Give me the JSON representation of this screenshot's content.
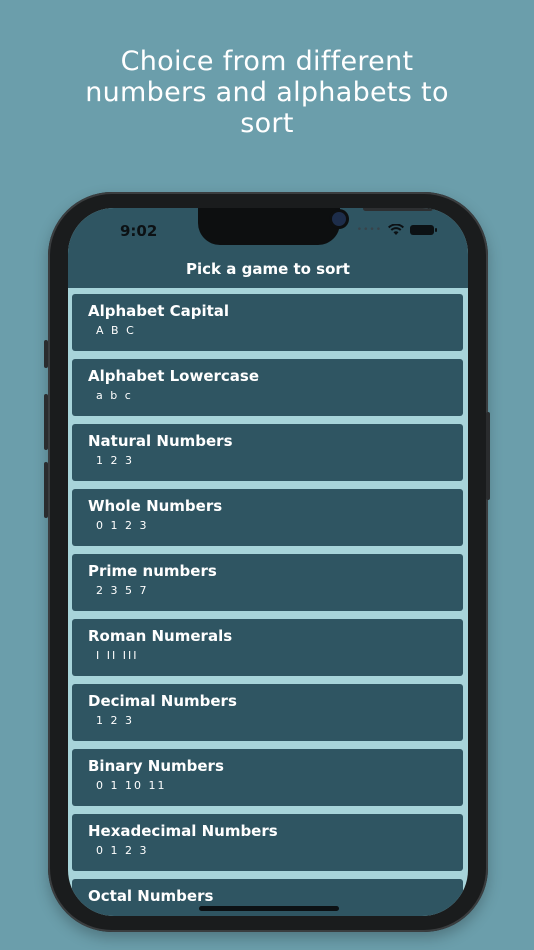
{
  "headline": {
    "line1": "Choice from different",
    "line2": "numbers and alphabets to",
    "line3": "sort"
  },
  "status_bar": {
    "time": "9:02",
    "icons": [
      "signal-icon",
      "wifi-icon",
      "battery-icon"
    ]
  },
  "nav": {
    "title": "Pick a game to sort"
  },
  "games": [
    {
      "title": "Alphabet Capital",
      "subtitle": "A B C"
    },
    {
      "title": "Alphabet Lowercase",
      "subtitle": "a b c"
    },
    {
      "title": "Natural Numbers",
      "subtitle": "1 2 3"
    },
    {
      "title": "Whole Numbers",
      "subtitle": "0 1 2 3"
    },
    {
      "title": "Prime numbers",
      "subtitle": "2 3 5 7"
    },
    {
      "title": "Roman Numerals",
      "subtitle": "I II III"
    },
    {
      "title": "Decimal Numbers",
      "subtitle": "1 2 3"
    },
    {
      "title": "Binary Numbers",
      "subtitle": "0 1 10 11"
    },
    {
      "title": "Hexadecimal Numbers",
      "subtitle": "0 1 2 3"
    },
    {
      "title": "Octal Numbers",
      "subtitle": ""
    }
  ],
  "colors": {
    "background": "#6b9eab",
    "app_bar": "#2f5562",
    "card": "#2f5562",
    "list_background": "#a7d4da"
  }
}
